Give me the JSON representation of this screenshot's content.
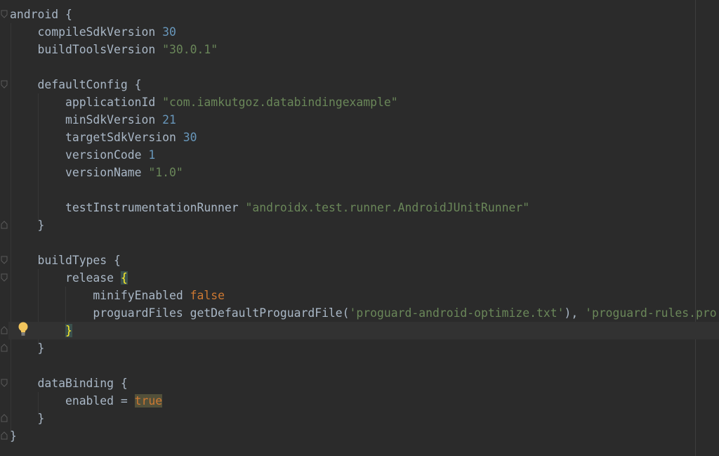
{
  "code": {
    "l1": {
      "text": "android {"
    },
    "l2": {
      "key": "compileSdkVersion",
      "value": "30"
    },
    "l3": {
      "key": "buildToolsVersion",
      "value": "\"30.0.1\""
    },
    "l5": {
      "text": "defaultConfig {"
    },
    "l6": {
      "key": "applicationId",
      "value": "\"com.iamkutgoz.databindingexample\""
    },
    "l7": {
      "key": "minSdkVersion",
      "value": "21"
    },
    "l8": {
      "key": "targetSdkVersion",
      "value": "30"
    },
    "l9": {
      "key": "versionCode",
      "value": "1"
    },
    "l10": {
      "key": "versionName",
      "value": "\"1.0\""
    },
    "l12": {
      "key": "testInstrumentationRunner",
      "value": "\"androidx.test.runner.AndroidJUnitRunner\""
    },
    "l13": {
      "text": "}"
    },
    "l15": {
      "text": "buildTypes {"
    },
    "l16": {
      "key": "release",
      "brace": "{"
    },
    "l17": {
      "key": "minifyEnabled",
      "value": "false"
    },
    "l18": {
      "prefix": "proguardFiles getDefaultProguardFile(",
      "arg1": "'proguard-android-optimize.txt'",
      "sep": "), ",
      "arg2": "'proguard-rules.pro'"
    },
    "l19": {
      "brace": "}"
    },
    "l20": {
      "text": "}"
    },
    "l22": {
      "text": "dataBinding {"
    },
    "l23": {
      "key": "enabled = ",
      "value": "true"
    },
    "l24": {
      "text": "}"
    },
    "l25": {
      "text": "}"
    }
  },
  "colors": {
    "background": "#2b2b2b",
    "text": "#a9b7c6",
    "number": "#6897bb",
    "string": "#6a8759",
    "keyword": "#cc7832",
    "brace_highlight": "#ffef28"
  },
  "icons": {
    "intention": "lightbulb-icon",
    "fold": "fold-marker-icon"
  }
}
